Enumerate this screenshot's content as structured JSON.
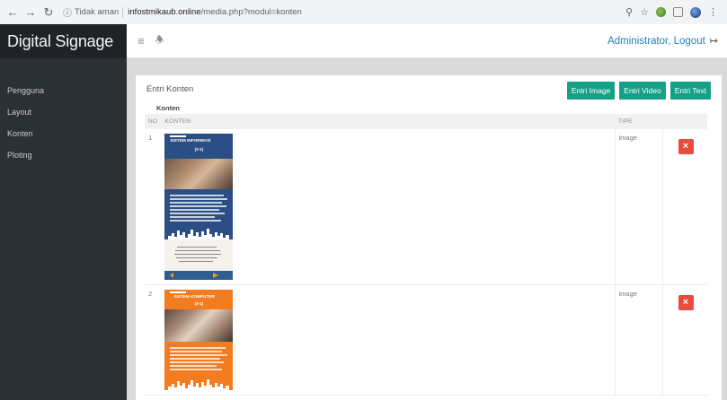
{
  "browser": {
    "security_label": "Tidak aman",
    "url_host": "infostmikaub.online",
    "url_path": "/media.php?modul=konten"
  },
  "app": {
    "brand": "Digital Signage",
    "user_link": "Administrator, Logout"
  },
  "sidebar": {
    "items": [
      {
        "label": "Pengguna"
      },
      {
        "label": "Layout"
      },
      {
        "label": "Konten"
      },
      {
        "label": "Ploting"
      }
    ]
  },
  "panel": {
    "title": "Entri Konten",
    "subtitle": "Konten",
    "buttons": {
      "entri_image": "Entri Image",
      "entri_video": "Entri Video",
      "entri_text": "Entri Text"
    }
  },
  "table": {
    "headers": {
      "no": "NO",
      "konten": "KONTEN",
      "tipe": "TIPE"
    },
    "rows": [
      {
        "no": "1",
        "tipe": "image",
        "poster": {
          "title": "SISTEM INFORMASI",
          "sub": "(S-1)",
          "color": "#2b4f84"
        }
      },
      {
        "no": "2",
        "tipe": "image",
        "poster": {
          "title": "SISTEM KOMPUTER",
          "sub": "(S-1)",
          "color": "#f47c20"
        }
      }
    ]
  },
  "colors": {
    "sidebar_bg": "#2b3035",
    "brand_bg": "#1f2327",
    "button_green": "#16a085",
    "delete_red": "#e74c3c",
    "link_blue": "#1e7fba"
  }
}
